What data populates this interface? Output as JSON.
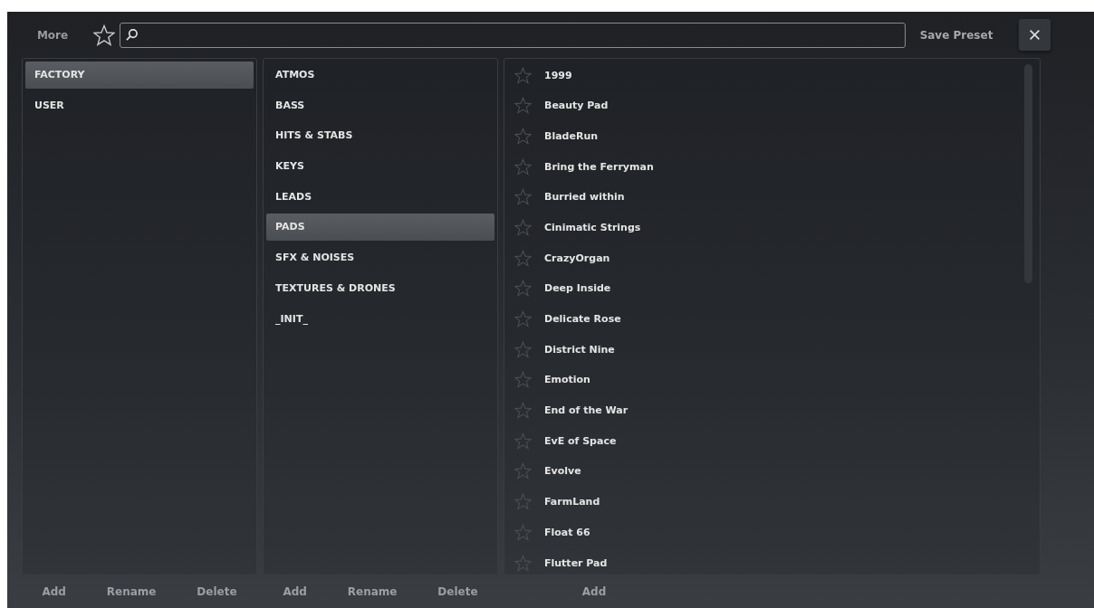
{
  "toolbar": {
    "more": "More",
    "favorites_filter": {
      "selected": false
    },
    "save_preset": "Save Preset"
  },
  "banks": {
    "items": [
      {
        "label": "FACTORY",
        "selected": true
      },
      {
        "label": "USER",
        "selected": false
      }
    ],
    "actions": [
      "Add",
      "Rename",
      "Delete"
    ]
  },
  "categories": {
    "items": [
      {
        "label": "ATMOS",
        "selected": false
      },
      {
        "label": "BASS",
        "selected": false
      },
      {
        "label": "HITS & STABS",
        "selected": false
      },
      {
        "label": "KEYS",
        "selected": false
      },
      {
        "label": "LEADS",
        "selected": false
      },
      {
        "label": "PADS",
        "selected": true
      },
      {
        "label": "SFX & NOISES",
        "selected": false
      },
      {
        "label": "TEXTURES & DRONES",
        "selected": false
      },
      {
        "label": "_INIT_",
        "selected": false
      }
    ],
    "actions": [
      "Add",
      "Rename",
      "Delete"
    ]
  },
  "presets": {
    "items": [
      {
        "label": "1999",
        "favorite": false
      },
      {
        "label": "Beauty Pad",
        "favorite": false
      },
      {
        "label": "BladeRun",
        "favorite": false
      },
      {
        "label": "Bring the Ferryman",
        "favorite": false
      },
      {
        "label": "Burried within",
        "favorite": false
      },
      {
        "label": "Cinimatic Strings",
        "favorite": false
      },
      {
        "label": "CrazyOrgan",
        "favorite": false
      },
      {
        "label": "Deep Inside",
        "favorite": false
      },
      {
        "label": "Delicate Rose",
        "favorite": false
      },
      {
        "label": "District Nine",
        "favorite": false
      },
      {
        "label": "Emotion",
        "favorite": false
      },
      {
        "label": "End of the War",
        "favorite": false
      },
      {
        "label": "EvE of Space",
        "favorite": false
      },
      {
        "label": "Evolve",
        "favorite": false
      },
      {
        "label": "FarmLand",
        "favorite": false
      },
      {
        "label": "Float 66",
        "favorite": false
      },
      {
        "label": "Flutter Pad",
        "favorite": false
      }
    ],
    "actions": [
      "Add"
    ]
  }
}
